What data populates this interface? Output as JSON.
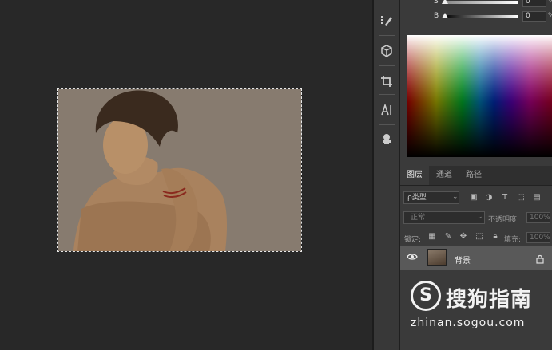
{
  "color_panel": {
    "sliders": [
      {
        "label": "S",
        "value": "0",
        "unit": "%"
      },
      {
        "label": "B",
        "value": "0",
        "unit": "%"
      }
    ]
  },
  "layers_panel": {
    "tabs": [
      {
        "label": "图层",
        "active": true
      },
      {
        "label": "通道",
        "active": false
      },
      {
        "label": "路径",
        "active": false
      }
    ],
    "filter_label": "ρ类型",
    "blend_mode": "正常",
    "opacity_label": "不透明度:",
    "opacity_value": "100%",
    "lock_label": "锁定:",
    "fill_label": "填充:",
    "fill_value": "100%",
    "layers": [
      {
        "name": "背景",
        "visible": true,
        "locked": true
      }
    ]
  },
  "watermark": {
    "logo_glyph": "S",
    "brand": "搜狗指南",
    "url": "zhinan.sogou.com"
  },
  "tools": [
    "brush-icon",
    "3d-object-icon",
    "crop-icon",
    "type-icon",
    "stamp-icon"
  ]
}
